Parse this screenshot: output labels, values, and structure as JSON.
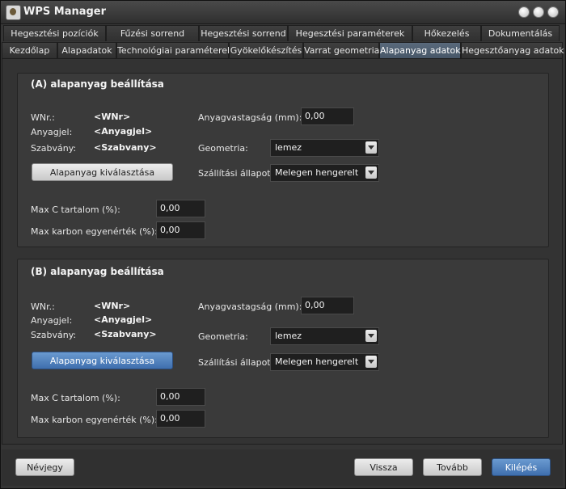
{
  "window": {
    "title": "WPS Manager"
  },
  "tabs": {
    "row1": [
      "Hegesztési pozíciók",
      "Fűzési sorrend",
      "Hegesztési sorrend",
      "Hegesztési paraméterek",
      "Hőkezelés",
      "Dokumentálás"
    ],
    "row2": [
      "Kezdőlap",
      "Alapadatok",
      "Technológiai paraméterek",
      "Gyökelőkészítés",
      "Varrat geometria",
      "Alapanyag adatok",
      "Hegesztőanyag adatok"
    ],
    "active": "Alapanyag adatok"
  },
  "group_a": {
    "title": "(A) alapanyag beállítása",
    "wnr_label": "WNr.:",
    "wnr_value": "<WNr>",
    "anyagjel_label": "Anyagjel:",
    "anyagjel_value": "<Anyagjel>",
    "szabvany_label": "Szabvány:",
    "szabvany_value": "<Szabvany>",
    "select_button": "Alapanyag kiválasztása",
    "thickness_label": "Anyagvastagság (mm):",
    "thickness_value": "0,00",
    "geometry_label": "Geometria:",
    "geometry_value": "lemez",
    "delivery_label": "Szállítási állapot:",
    "delivery_value": "Melegen hengerelt",
    "maxc_label": "Max C tartalom (%):",
    "maxc_value": "0,00",
    "maxcev_label": "Max karbon egyenérték (%):",
    "maxcev_value": "0,00"
  },
  "group_b": {
    "title": "(B) alapanyag beállítása",
    "wnr_label": "WNr.:",
    "wnr_value": "<WNr>",
    "anyagjel_label": "Anyagjel:",
    "anyagjel_value": "<Anyagjel>",
    "szabvany_label": "Szabvány:",
    "szabvany_value": "<Szabvany>",
    "select_button": "Alapanyag kiválasztása",
    "thickness_label": "Anyagvastagság (mm):",
    "thickness_value": "0,00",
    "geometry_label": "Geometria:",
    "geometry_value": "lemez",
    "delivery_label": "Szállítási állapot:",
    "delivery_value": "Melegen hengerelt",
    "maxc_label": "Max C tartalom (%):",
    "maxc_value": "0,00",
    "maxcev_label": "Max karbon egyenérték (%):",
    "maxcev_value": "0,00"
  },
  "footer": {
    "about": "Névjegy",
    "back": "Vissza",
    "next": "Tovább",
    "exit": "Kilépés"
  },
  "colors": {
    "accent": "#4f7fbf",
    "background": "#353535"
  }
}
